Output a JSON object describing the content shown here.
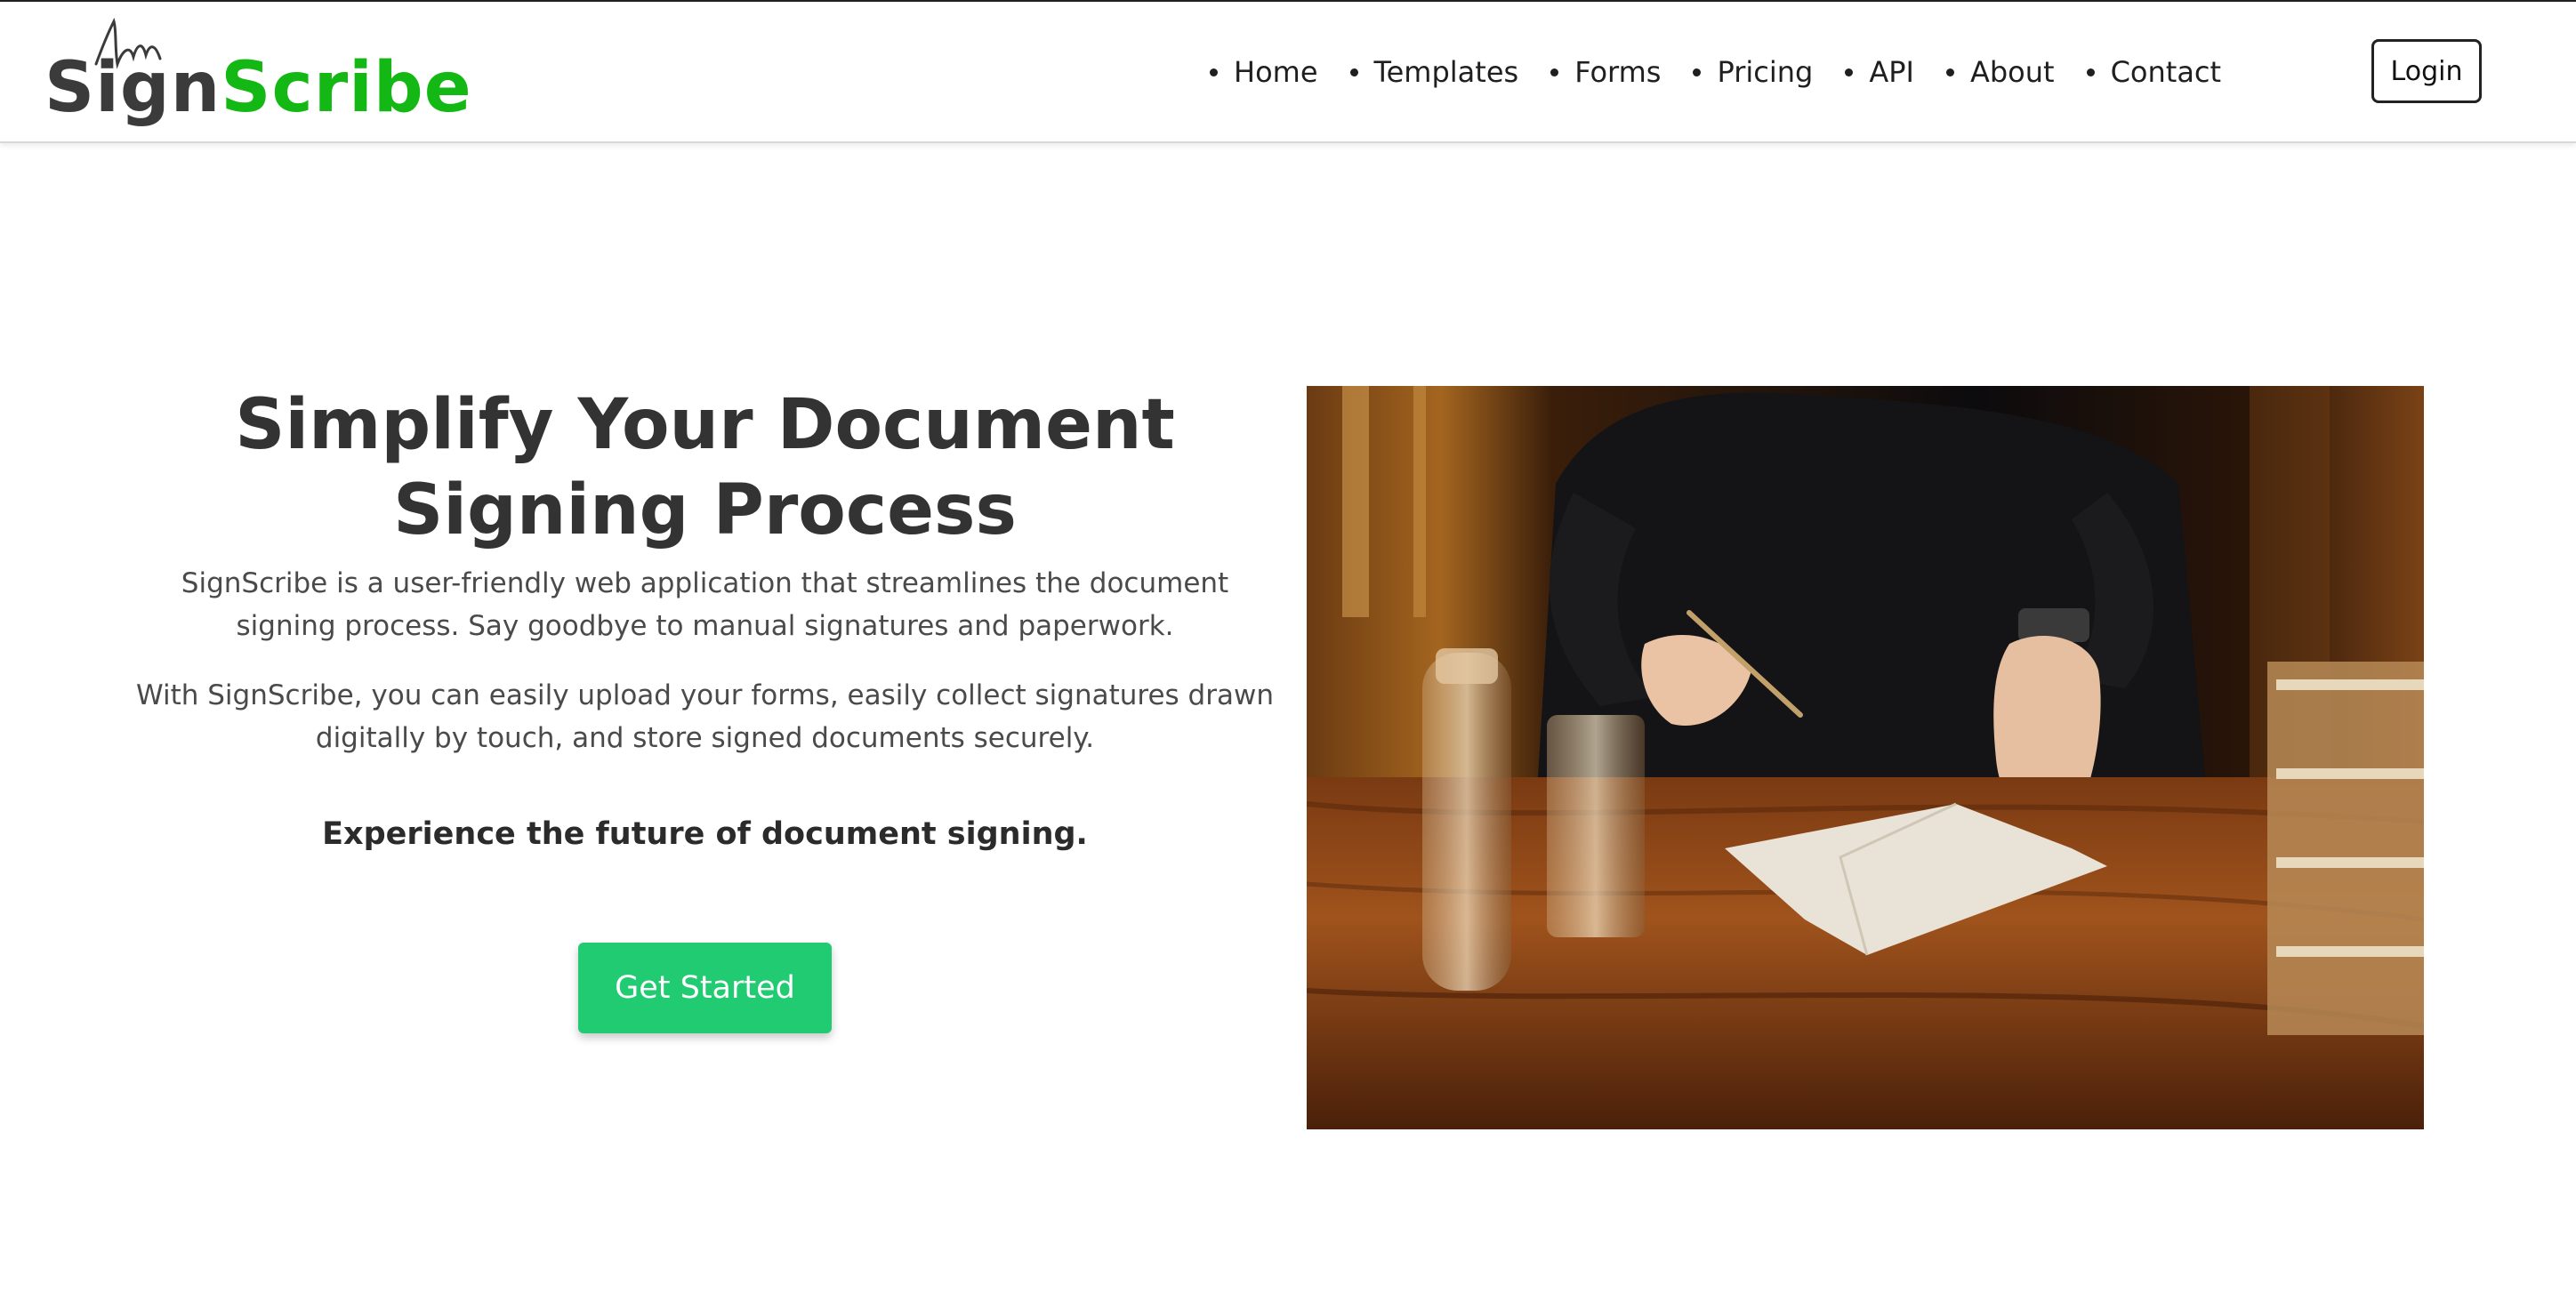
{
  "brand": {
    "part1": "Sign",
    "part2": "Scribe",
    "colors": {
      "dark": "#3b3b3b",
      "accent": "#14b814"
    }
  },
  "nav": {
    "items": [
      {
        "label": "Home"
      },
      {
        "label": "Templates"
      },
      {
        "label": "Forms"
      },
      {
        "label": "Pricing"
      },
      {
        "label": "API"
      },
      {
        "label": "About"
      },
      {
        "label": "Contact"
      }
    ],
    "login_label": "Login"
  },
  "hero": {
    "title": "Simplify Your Document Signing Process",
    "paragraph1": "SignScribe is a user-friendly web application that streamlines the document signing process. Say goodbye to manual signatures and paperwork.",
    "paragraph2": "With SignScribe, you can easily upload your forms, easily collect signatures drawn digitally by touch, and store signed documents securely.",
    "tagline": "Experience the future of document signing.",
    "cta_label": "Get Started",
    "cta_color": "#20cb72",
    "image": "photo of a person signing a document at a wooden table beside glasses of water and a stack of books"
  }
}
